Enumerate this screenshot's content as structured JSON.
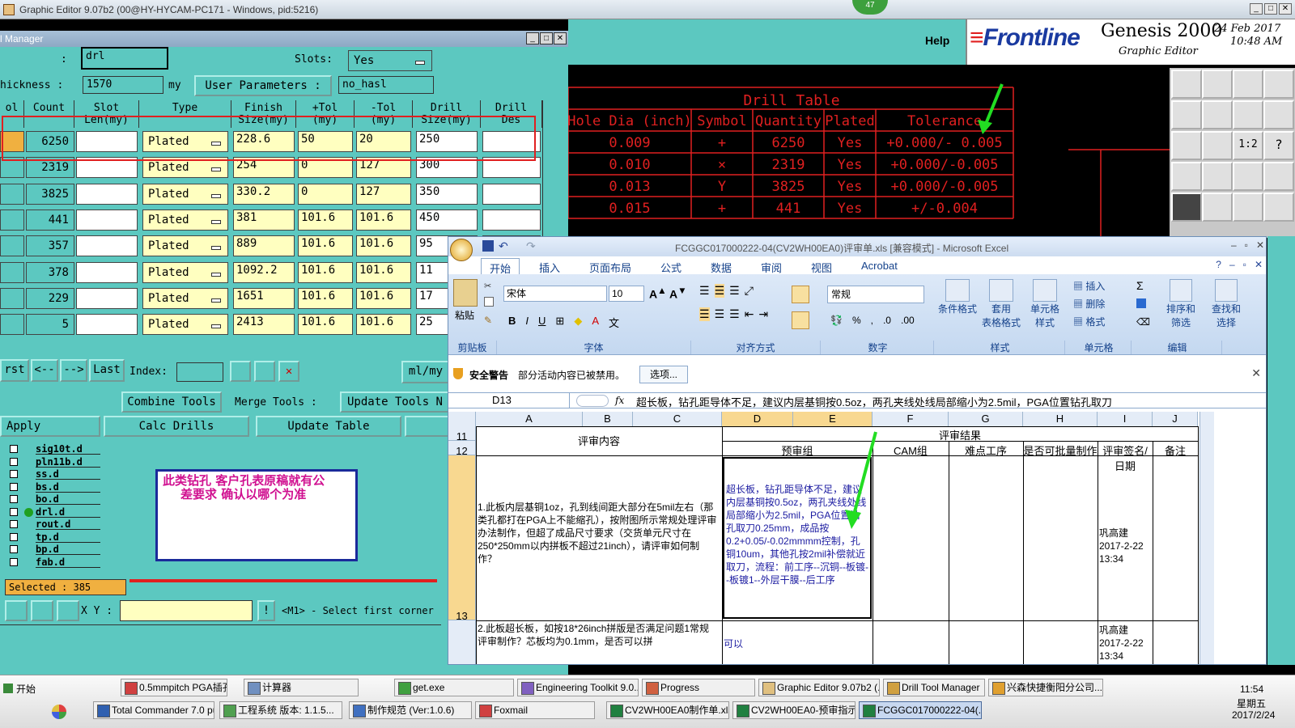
{
  "genesis": {
    "title": "Graphic Editor 9.07b2 (00@HY-HYCAM-PC171 - Windows, pid:5216)",
    "badge": "47",
    "help_label": "Help",
    "brand": "Frontline",
    "product": "Genesis 2000",
    "product_sub": "Graphic Editor",
    "date": "24 Feb 2017",
    "time": "10:48 AM",
    "status_prompt": "<M1> - Select first corner",
    "xy_label": "X Y :",
    "selected_label": "Selected : 385",
    "layers": [
      "sig10t.d",
      "pln11b.d",
      "ss.d",
      "bs.d",
      "bo.d",
      "drl.d",
      "rout.d",
      "tp.d",
      "bp.d",
      "fab.d"
    ]
  },
  "drill_manager": {
    "title": "l Manager",
    "layer_label": ":",
    "layer_value": "drl",
    "slots_label": "Slots:",
    "slots_value": "Yes",
    "thickness_label": "hickness :",
    "thickness_value": "1570",
    "thickness_unit": "my",
    "user_params_label": "User Parameters :",
    "user_params_value": "no_hasl",
    "columns": [
      {
        "line1": "ol",
        "line2": ""
      },
      {
        "line1": "Count",
        "line2": ""
      },
      {
        "line1": "Slot",
        "line2": "Len(my)"
      },
      {
        "line1": "Type",
        "line2": ""
      },
      {
        "line1": "Finish",
        "line2": "Size(my)"
      },
      {
        "line1": "+Tol",
        "line2": "(my)"
      },
      {
        "line1": "-Tol",
        "line2": "(my)"
      },
      {
        "line1": "Drill",
        "line2": "Size(my)"
      },
      {
        "line1": "Drill",
        "line2": "Des"
      }
    ],
    "rows": [
      {
        "count": "6250",
        "type": "Plated",
        "finish": "228.6",
        "ptol": "50",
        "ntol": "20",
        "drill": "250"
      },
      {
        "count": "2319",
        "type": "Plated",
        "finish": "254",
        "ptol": "0",
        "ntol": "127",
        "drill": "300"
      },
      {
        "count": "3825",
        "type": "Plated",
        "finish": "330.2",
        "ptol": "0",
        "ntol": "127",
        "drill": "350"
      },
      {
        "count": "441",
        "type": "Plated",
        "finish": "381",
        "ptol": "101.6",
        "ntol": "101.6",
        "drill": "450"
      },
      {
        "count": "357",
        "type": "Plated",
        "finish": "889",
        "ptol": "101.6",
        "ntol": "101.6",
        "drill": "95"
      },
      {
        "count": "378",
        "type": "Plated",
        "finish": "1092.2",
        "ptol": "101.6",
        "ntol": "101.6",
        "drill": "11"
      },
      {
        "count": "229",
        "type": "Plated",
        "finish": "1651",
        "ptol": "101.6",
        "ntol": "101.6",
        "drill": "17"
      },
      {
        "count": "5",
        "type": "Plated",
        "finish": "2413",
        "ptol": "101.6",
        "ntol": "101.6",
        "drill": "25"
      }
    ],
    "nav": {
      "first": "rst",
      "prev": "<--",
      "next": "-->",
      "last": "Last",
      "index_label": "Index:",
      "units": "ml/my"
    },
    "combine_tools": "Combine Tools",
    "merge_tools": "Merge Tools :",
    "update_tools": "Update Tools N",
    "apply": "Apply",
    "calc_drills": "Calc Drills",
    "update_table": "Update Table"
  },
  "note_box": {
    "line1": "此类钻孔  客户孔表原稿就有公",
    "line2": "差要求  确认以哪个为准"
  },
  "drill_table": {
    "title": "Drill Table",
    "headers": [
      "Hole Dia (inch)",
      "Symbol",
      "Quantity",
      "Plated",
      "Tolerance"
    ],
    "rows": [
      [
        "0.009",
        "+",
        "6250",
        "Yes",
        "+0.000/- 0.005"
      ],
      [
        "0.010",
        "×",
        "2319",
        "Yes",
        "+0.000/-0.005"
      ],
      [
        "0.013",
        "Y",
        "3825",
        "Yes",
        "+0.000/-0.005"
      ],
      [
        "0.015",
        "+",
        "441",
        "Yes",
        "+/-0.004"
      ]
    ]
  },
  "excel": {
    "title": "FCGGC017000222-04(CV2WH00EA0)评审单.xls  [兼容模式] - Microsoft Excel",
    "tabs": [
      "开始",
      "插入",
      "页面布局",
      "公式",
      "数据",
      "审阅",
      "视图",
      "Acrobat"
    ],
    "groups": [
      "剪贴板",
      "字体",
      "对齐方式",
      "数字",
      "样式",
      "单元格",
      "编辑"
    ],
    "paste": "粘贴",
    "font_name": "宋体",
    "font_size": "10",
    "number_format": "常规",
    "style_buttons": [
      "条件格式",
      "套用\n表格格式",
      "单元格\n样式"
    ],
    "cell_buttons": [
      "插入",
      "删除",
      "格式"
    ],
    "edit_buttons": [
      "排序和\n筛选",
      "查找和\n选择"
    ],
    "security_label": "安全警告",
    "security_text": "部分活动内容已被禁用。",
    "options_button": "选项...",
    "name_box": "D13",
    "fx": "fx",
    "formula": "超长板，钻孔距导体不足，建议内层基铜按0.5oz，两孔夹线处线局部缩小为2.5mil，PGA位置钻孔取刀",
    "columns": [
      "A",
      "B",
      "C",
      "D",
      "E",
      "F",
      "G",
      "H",
      "I",
      "J"
    ],
    "row_numbers": [
      "11",
      "12",
      "13"
    ],
    "review_content": "评审内容",
    "review_result": "评审结果",
    "sub_headers": [
      "预审组",
      "CAM组",
      "难点工序",
      "是否可批量制作",
      "评审签名/日期",
      "备注"
    ],
    "row13_question": "1.此板内层基铜1oz，孔到线间距大部分在5mil左右（那类孔都打在PGA上不能缩孔），按附图所示常规处理评审办法制作，但超了成品尺寸要求（交货单元尺寸在250*250mm以内拼板不超过21inch），请评审如何制作？",
    "row13_answer": "超长板，钻孔距导体不足，建议内层基铜按0.5oz，两孔夹线处线局部缩小为2.5mil，PGA位置钻孔取刀0.25mm，成品按0.2+0.05/-0.02mmmm控制，孔铜10um，其他孔按2mil补偿就近取刀，流程：前工序--沉铜--板镀--板镀1--外层干膜--后工序",
    "row13_sign": "巩高建 2017-2-22 13:34",
    "row14_question": "2.此板超长板，如按18*26inch拼版是否满足问题1常规评审制作？芯板均为0.1mm，是否可以拼",
    "row14_answer": "可以",
    "row14_sign": "巩高建 2017-2-22 13:34"
  },
  "taskbar": {
    "start": "开始",
    "row1": [
      "0.5mmpitch PGA插孔...",
      "计算器",
      "get.exe",
      "Engineering Toolkit 9.0...",
      "Progress",
      "Graphic Editor 9.07b2 (...",
      "Drill Tool Manager",
      "兴森快捷衡阳分公司..."
    ],
    "row2": [
      "Total Commander 7.0 pu...",
      "工程系统  版本: 1.1.5...",
      "制作规范 (Ver:1.0.6)",
      "Foxmail",
      "CV2WH00EA0制作单.xls...",
      "CV2WH00EA0-预审指示...",
      "FCGGC017000222-04(..."
    ],
    "clock_time": "11:54",
    "clock_day": "星期五",
    "clock_date": "2017/2/24"
  },
  "colors": {
    "teal": "#5cc8c0",
    "cell_yellow": "#ffffc0",
    "drill_red": "#e02020",
    "arrow_green": "#22dd22",
    "note_magenta": "#d01090"
  }
}
